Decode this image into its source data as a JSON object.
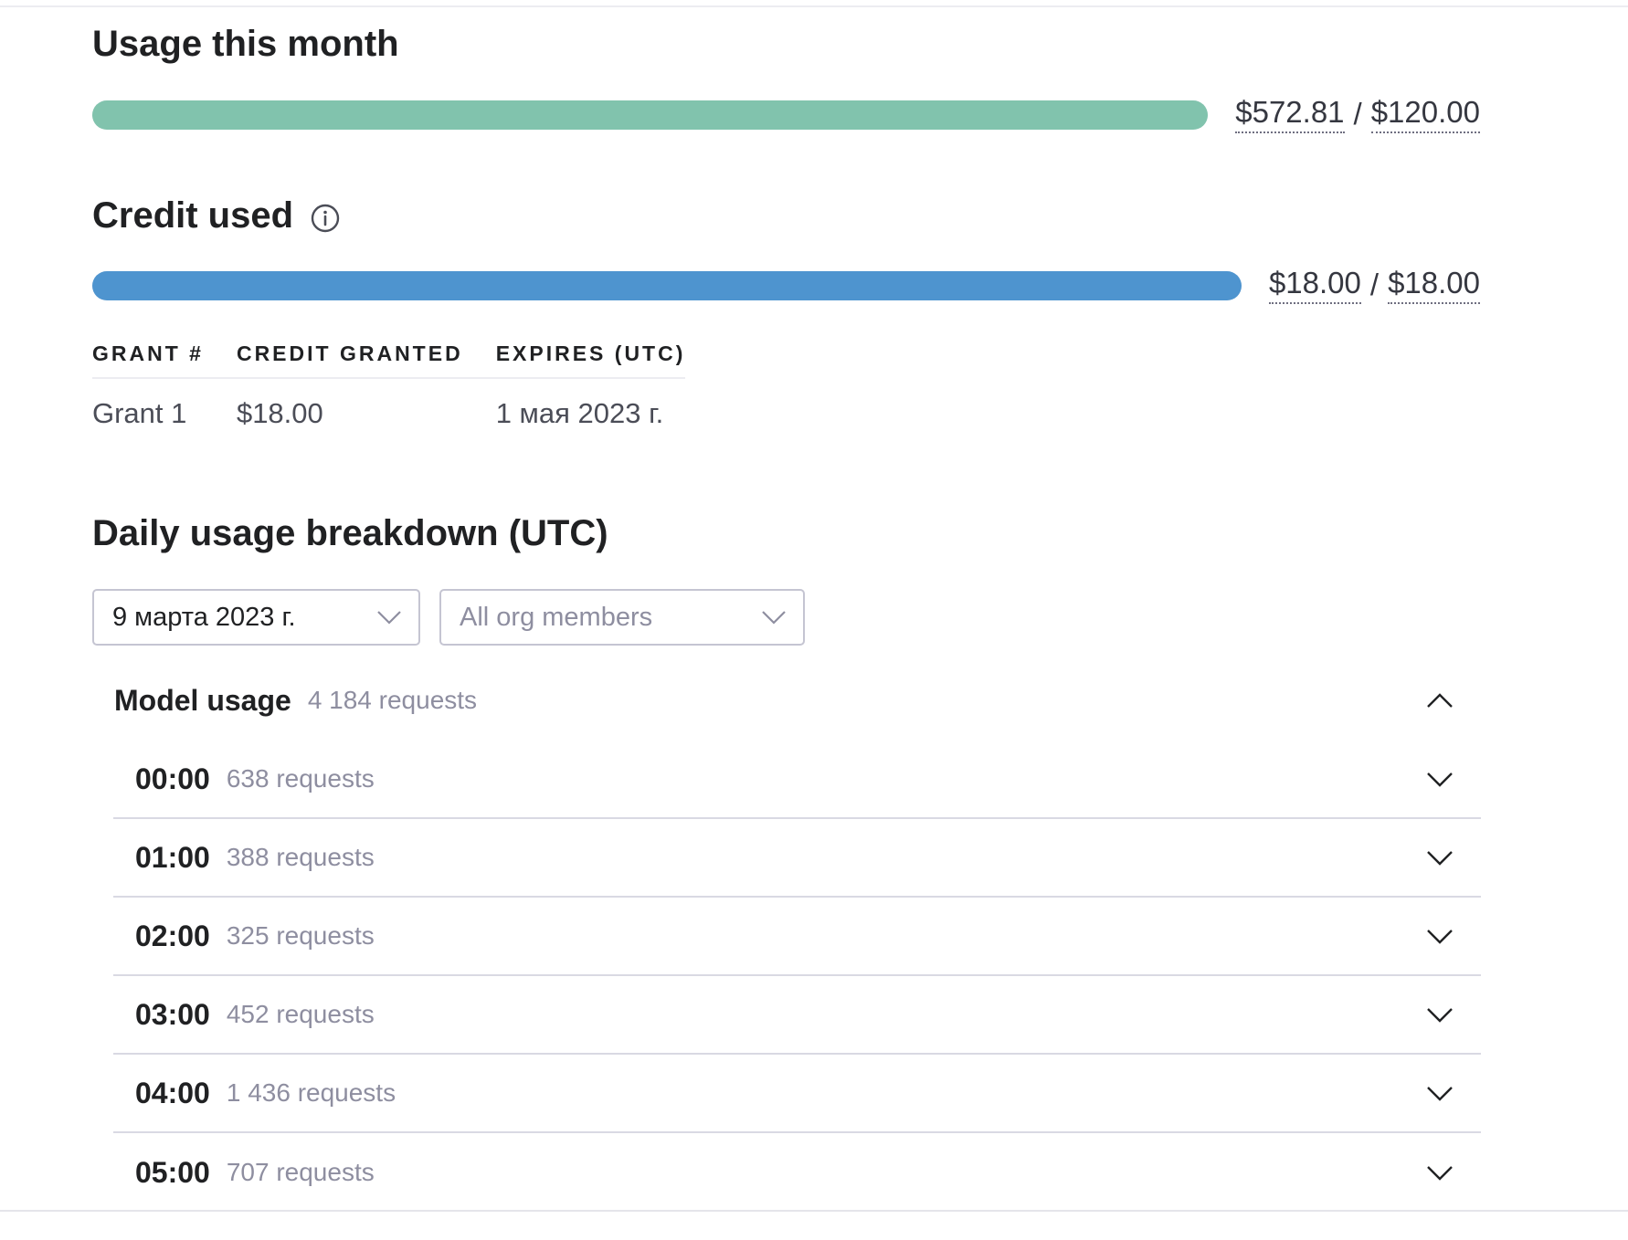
{
  "usage": {
    "title": "Usage this month",
    "used": "$572.81",
    "separator": "/",
    "limit": "$120.00",
    "fill_fraction": 1.0,
    "bar_color": "#81c3ad"
  },
  "credit": {
    "title": "Credit used",
    "info_icon": "info-icon",
    "used": "$18.00",
    "separator": "/",
    "total": "$18.00",
    "fill_fraction": 1.0,
    "bar_color": "#4e94cf",
    "table": {
      "headers": [
        "GRANT #",
        "CREDIT GRANTED",
        "EXPIRES (UTC)"
      ],
      "rows": [
        {
          "grant": "Grant 1",
          "amount": "$18.00",
          "expires": "1 мая 2023 г."
        }
      ]
    }
  },
  "daily": {
    "title": "Daily usage breakdown (UTC)",
    "date_select": {
      "value": "9 марта 2023 г.",
      "icon": "chevron-down-icon"
    },
    "members_select": {
      "value": "All org members",
      "icon": "chevron-down-icon"
    },
    "model_usage": {
      "label": "Model usage",
      "count": "4 184 requests",
      "expanded": true,
      "icon": "chevron-up-icon",
      "hours": [
        {
          "time": "00:00",
          "requests": "638 requests"
        },
        {
          "time": "01:00",
          "requests": "388 requests"
        },
        {
          "time": "02:00",
          "requests": "325 requests"
        },
        {
          "time": "03:00",
          "requests": "452 requests"
        },
        {
          "time": "04:00",
          "requests": "1 436 requests"
        },
        {
          "time": "05:00",
          "requests": "707 requests"
        }
      ]
    }
  }
}
